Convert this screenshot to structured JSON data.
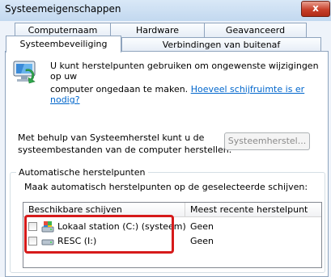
{
  "window": {
    "title": "Systeemeigenschappen",
    "close_glyph": "x"
  },
  "tabs": {
    "computernaam": "Computernaam",
    "hardware": "Hardware",
    "geavanceerd": "Geavanceerd",
    "systeembeveiliging": "Systeembeveiliging",
    "verbindingen": "Verbindingen van buitenaf"
  },
  "intro": {
    "text_line1": "U kunt herstelpunten gebruiken om ongewenste wijzigingen op uw",
    "text_line2": "computer ongedaan te maken.",
    "link": "Hoeveel schijfruimte is er nodig?"
  },
  "restore": {
    "text_line1": "Met behulp van Systeemherstel kunt u de",
    "text_line2": "systeembestanden van de computer herstellen.",
    "button": "Systeemherstel..."
  },
  "auto": {
    "group_title": "Automatische herstelpunten",
    "description": "Maak automatisch herstelpunten op de geselecteerde schijven:",
    "columns": {
      "drives": "Beschikbare schijven",
      "recent": "Meest recente herstelpunt"
    },
    "rows": [
      {
        "name": "Lokaal station (C:) (systeem)",
        "recent": "Geen",
        "checked": false
      },
      {
        "name": "RESC (I:)",
        "recent": "Geen",
        "checked": false
      }
    ]
  }
}
